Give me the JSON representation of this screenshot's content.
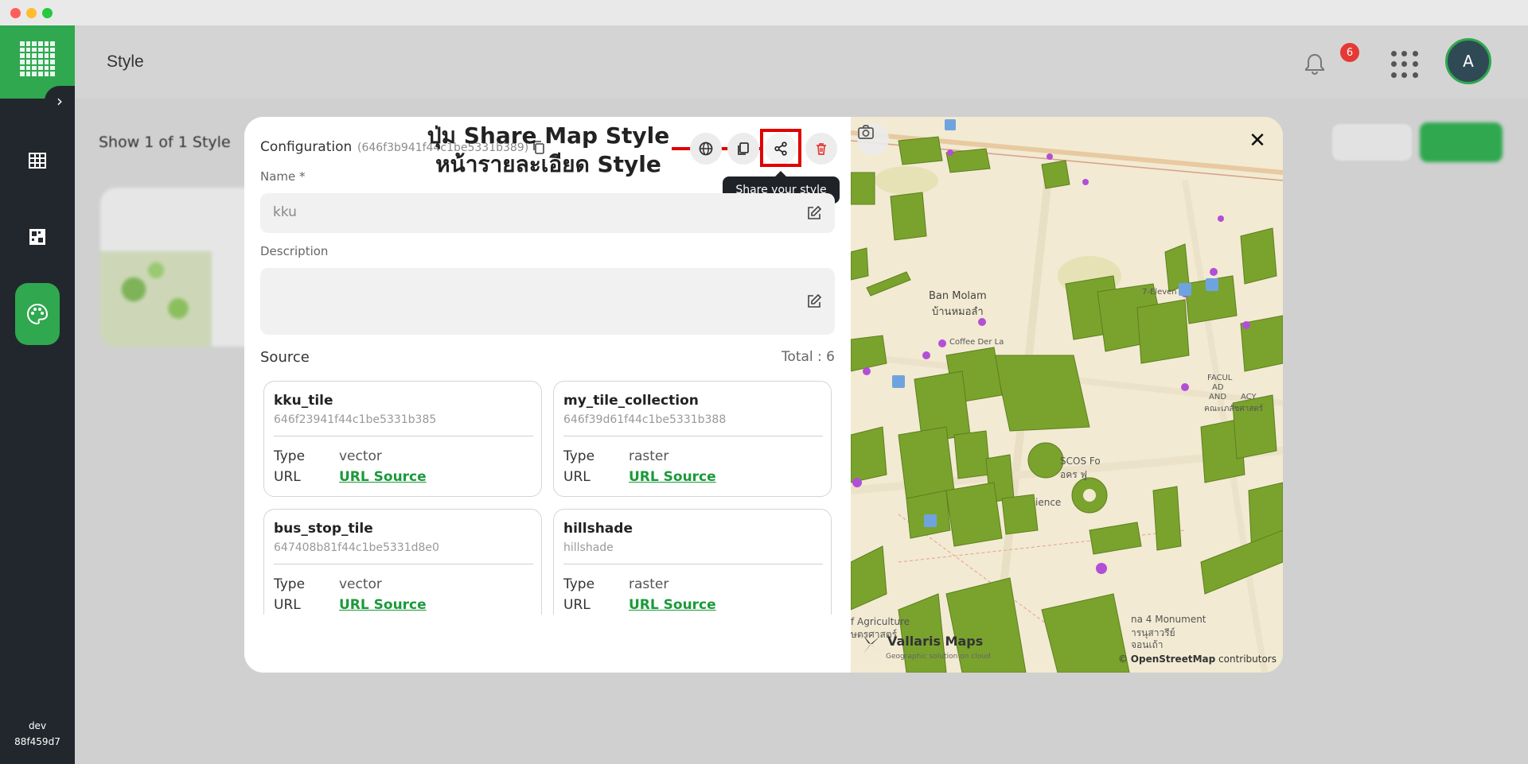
{
  "window": {
    "title": ""
  },
  "sidebar": {
    "items": [
      {
        "name": "table-icon"
      },
      {
        "name": "tiles-icon"
      },
      {
        "name": "palette-icon",
        "active": true
      }
    ],
    "env": "dev",
    "build": "88f459d7"
  },
  "header": {
    "title": "Style",
    "notification_count": "6",
    "avatar_initial": "A"
  },
  "background": {
    "show_count": "Show 1 of 1 Style"
  },
  "modal": {
    "title": "Configuration",
    "config_id": "(646f3b941f44c1be5331b389)",
    "tooltip": "Share your style",
    "annotation_line1": "ปุ่ม Share Map Style",
    "annotation_line2": "หน้ารายละเอียด Style",
    "name_label": "Name *",
    "name_value": "kku",
    "description_label": "Description",
    "description_value": "",
    "source_label": "Source",
    "source_total": "Total : 6",
    "type_label": "Type",
    "url_label": "URL",
    "sources": [
      {
        "name": "kku_tile",
        "id": "646f23941f44c1be5331b385",
        "type": "vector",
        "url_text": "URL Source"
      },
      {
        "name": "my_tile_collection",
        "id": "646f39d61f44c1be5331b388",
        "type": "raster",
        "url_text": "URL Source"
      },
      {
        "name": "bus_stop_tile",
        "id": "647408b81f44c1be5331d8e0",
        "type": "vector",
        "url_text": "URL Source"
      },
      {
        "name": "hillshade",
        "id": "hillshade",
        "type": "raster",
        "url_text": "URL Source"
      }
    ]
  },
  "map": {
    "labels": {
      "ban_molam": "Ban Molam",
      "ban_molam_th": "บ้านหมอลำ",
      "seven_eleven": "7-Eleven",
      "agriculture": "f Agriculture",
      "agriculture_th": "ษตรศาสตร์",
      "monument": "na 4 Monument",
      "monument_th": "จอนเถ้า",
      "monument_th2": "ารนุสาวรีย์",
      "scos": "SCOS Fo",
      "scos_th": "อคร ฟู",
      "science": "ience",
      "faculty": "FACUL",
      "faculty2": "AD",
      "faculty3": "AND",
      "pharmacy": "ACY",
      "pharmacy_th": "คณะเภสัชศาสตร์",
      "coffee": "Coffee Der La"
    },
    "brand": "Vallaris Maps",
    "brand_sub": "Geographic solution on cloud",
    "attribution_prefix": "© ",
    "attribution_osm": "OpenStreetMap",
    "attribution_suffix": " contributors"
  },
  "colors": {
    "brand_green": "#2fa84f",
    "sidebar_dark": "#22272d",
    "highlight_red": "#e10000",
    "building_green": "#7aa32e",
    "link_green": "#1a9a3a"
  }
}
